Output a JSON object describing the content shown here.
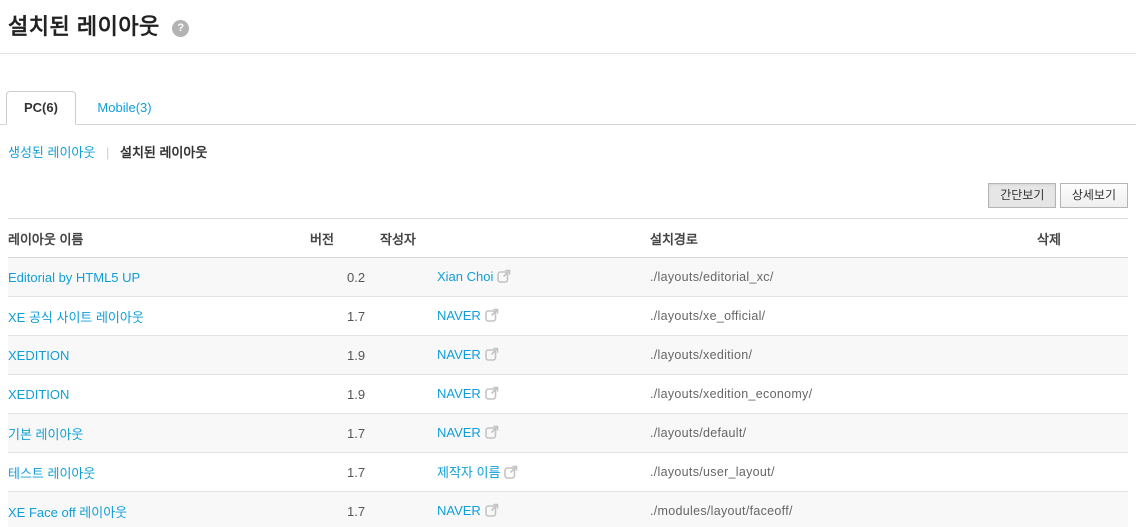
{
  "page": {
    "title": "설치된 레이아웃",
    "help_label": "?"
  },
  "tabs": [
    {
      "label": "PC(6)",
      "active": true
    },
    {
      "label": "Mobile(3)",
      "active": false
    }
  ],
  "subnav": {
    "created_label": "생성된 레이아웃",
    "separator": "|",
    "installed_label": "설치된 레이아웃"
  },
  "view_buttons": {
    "simple_label": "간단보기",
    "detail_label": "상세보기"
  },
  "table": {
    "columns": {
      "name": "레이아웃 이름",
      "version": "버전",
      "author": "작성자",
      "path": "설치경로",
      "delete": "삭제"
    },
    "rows": [
      {
        "name": "Editorial by HTML5 UP",
        "version": "0.2",
        "author": "Xian Choi",
        "path": "./layouts/editorial_xc/"
      },
      {
        "name": "XE 공식 사이트 레이아웃",
        "version": "1.7",
        "author": "NAVER",
        "path": "./layouts/xe_official/"
      },
      {
        "name": "XEDITION",
        "version": "1.9",
        "author": "NAVER",
        "path": "./layouts/xedition/"
      },
      {
        "name": "XEDITION",
        "version": "1.9",
        "author": "NAVER",
        "path": "./layouts/xedition_economy/"
      },
      {
        "name": "기본 레이아웃",
        "version": "1.7",
        "author": "NAVER",
        "path": "./layouts/default/"
      },
      {
        "name": "테스트 레이아웃",
        "version": "1.7",
        "author": "제작자 이름",
        "path": "./layouts/user_layout/"
      },
      {
        "name": "XE Face off 레이아웃",
        "version": "1.7",
        "author": "NAVER",
        "path": "./modules/layout/faceoff/"
      }
    ]
  },
  "colors": {
    "link": "#0f9ed8",
    "row_stripe": "#f8f8f8",
    "border": "#e3e3e3",
    "help_badge": "#b3b3b3"
  }
}
